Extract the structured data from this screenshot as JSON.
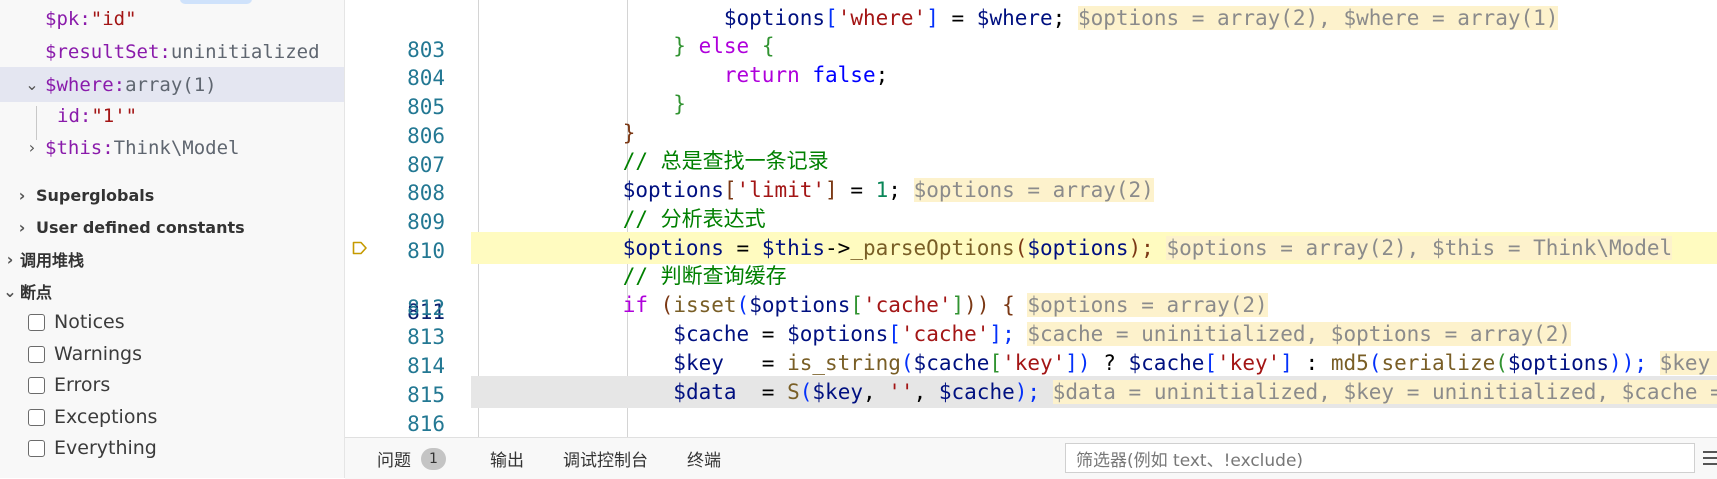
{
  "variables": [
    {
      "name": "$pk",
      "sep": ": ",
      "value": "\"id\"",
      "kind": "string"
    },
    {
      "name": "$resultSet",
      "sep": ": ",
      "value": "uninitialized",
      "kind": "plain"
    },
    {
      "name": "$where",
      "sep": ": ",
      "value": "array(1)",
      "kind": "plain"
    },
    {
      "name": "id",
      "sep": ": ",
      "value": "\"1'\"",
      "kind": "string"
    },
    {
      "name": "$this",
      "sep": ": ",
      "value": "Think\\Model",
      "kind": "plain"
    }
  ],
  "sections": {
    "superglobals": "Superglobals",
    "constants": "User defined constants",
    "callstack": "调用堆栈",
    "breakpoints": "断点"
  },
  "breakpoints": [
    "Notices",
    "Warnings",
    "Errors",
    "Exceptions",
    "Everything"
  ],
  "code": {
    "line_numbers": [
      "803",
      "804",
      "805",
      "806",
      "807",
      "808",
      "809",
      "810",
      "811",
      "812",
      "813",
      "814",
      "815",
      "816"
    ],
    "current_line": "811",
    "l803": {
      "a": "$options",
      "b": "[",
      "c": "'where'",
      "d": "]",
      "e": " = ",
      "f": "$where",
      "g": ";",
      "h": "$options = array(2), $where = array(1)"
    },
    "l804": {
      "a": "}",
      "b": " else ",
      "c": "{"
    },
    "l805": {
      "a": "return",
      "b": " false",
      "c": ";"
    },
    "l806": {
      "a": "}"
    },
    "l807": {
      "a": "}"
    },
    "l808": {
      "a": "// 总是查找一条记录"
    },
    "l809": {
      "a": "$options",
      "b": "[",
      "c": "'limit'",
      "d": "]",
      "e": " = ",
      "f": "1",
      "g": ";",
      "h": "$options = array(2)"
    },
    "l810": {
      "a": "// 分析表达式"
    },
    "l811": {
      "a": "$options",
      "b": " = ",
      "c": "$this",
      "d": "->",
      "e": "_parseOptions",
      "f": "(",
      "g": "$options",
      "h": ");",
      "i": "$options = array(2), $this = Think\\Model"
    },
    "l812": {
      "a": "// 判断查询缓存"
    },
    "l813": {
      "a": "if",
      "b": " (",
      "c": "isset",
      "d": "(",
      "e": "$options",
      "f": "[",
      "g": "'cache'",
      "h": "]",
      "i": "))",
      "j": " {",
      "k": "$options = array(2)"
    },
    "l814": {
      "a": "$cache",
      "b": " = ",
      "c": "$options",
      "d": "[",
      "e": "'cache'",
      "f": "];",
      "g": "$cache = uninitialized, $options = array(2)"
    },
    "l815": {
      "a": "$key",
      "b": "   = ",
      "c": "is_string",
      "d": "(",
      "e": "$cache",
      "f": "[",
      "g": "'key'",
      "h": "])",
      "i": " ? ",
      "j": "$cache",
      "k": "[",
      "l": "'key'",
      "m": "]",
      "n": " : ",
      "o": "md5",
      "p": "(",
      "q": "serialize",
      "r": "(",
      "s": "$options",
      "t": "));",
      "u": "$key ="
    },
    "l816": {
      "a": "$data",
      "b": "  = ",
      "c": "S",
      "d": "(",
      "e": "$key",
      "f": ", ",
      "g": "''",
      "h": ", ",
      "i": "$cache",
      "j": ");",
      "k": "$data = uninitialized, $key = uninitialized, $cache ="
    }
  },
  "panel": {
    "tabs": [
      "问题",
      "输出",
      "调试控制台",
      "终端"
    ],
    "problems_count": "1",
    "filter_placeholder": "筛选器(例如 text、!exclude)"
  },
  "colors": {
    "current_line_bg": "#fffbc0",
    "inline_value_bg": "#fdf2cc",
    "variable_name": "#8a1bab"
  }
}
